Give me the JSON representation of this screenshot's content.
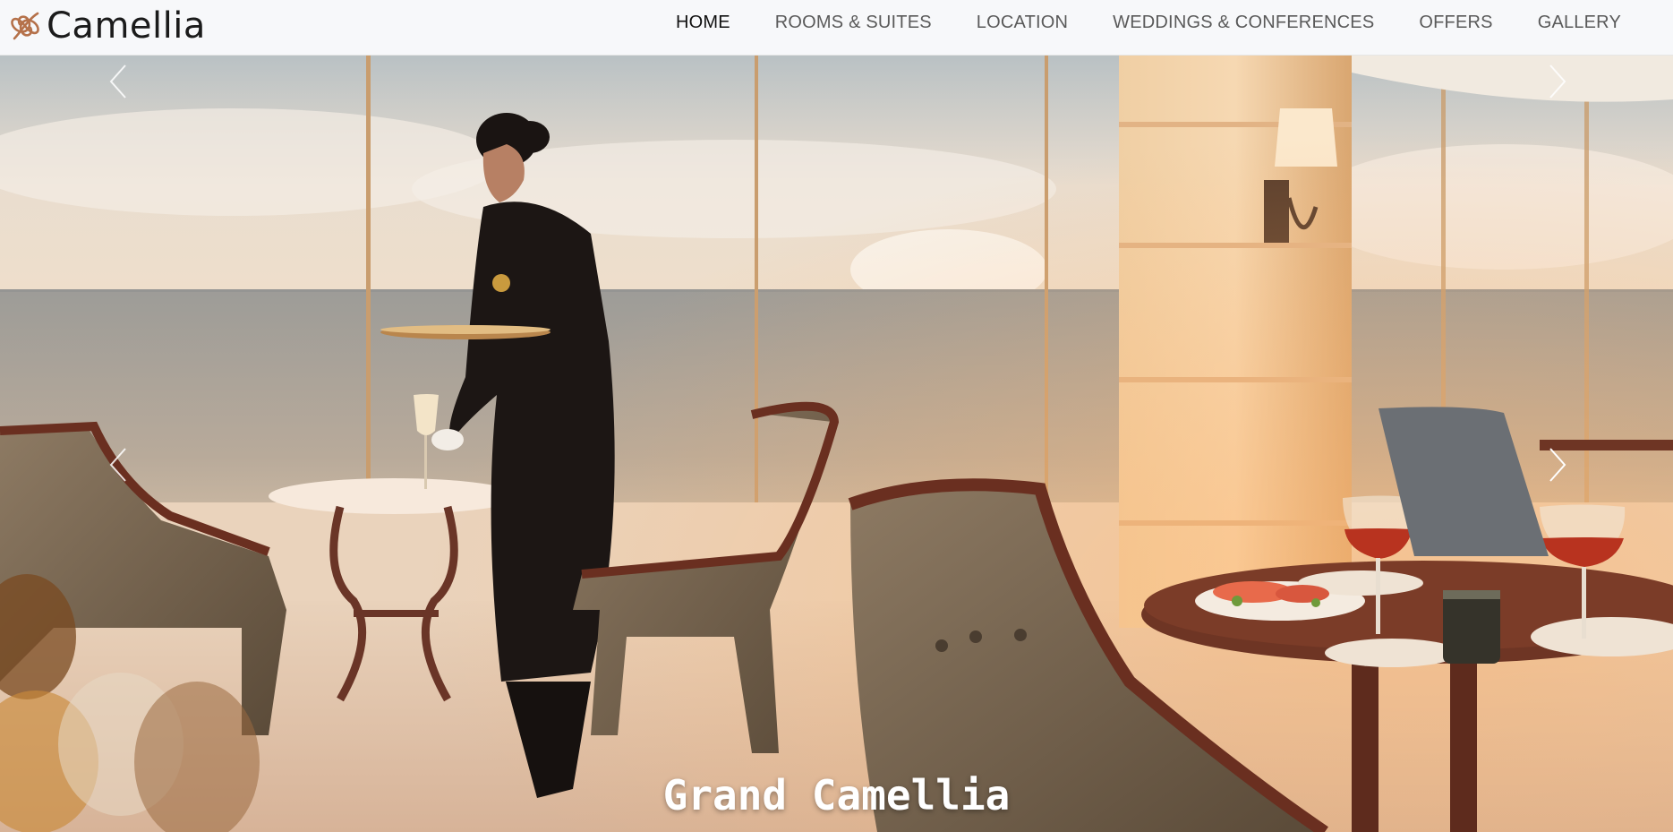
{
  "brand": {
    "name": "Camellia",
    "logo_icon": "camellia-knot-logo-icon",
    "logo_color": "#b5714a"
  },
  "nav": {
    "items": [
      {
        "label": "HOME",
        "active": true
      },
      {
        "label": "ROOMS & SUITES",
        "active": false
      },
      {
        "label": "LOCATION",
        "active": false
      },
      {
        "label": "WEDDINGS & CONFERENCES",
        "active": false
      },
      {
        "label": "OFFERS",
        "active": false
      },
      {
        "label": "GALLERY",
        "active": false
      }
    ]
  },
  "hero": {
    "caption": "Grand Camellia",
    "image": "restaurant-ocean-view-photo",
    "controls": {
      "prev_icon": "chevron-left-icon",
      "next_icon": "chevron-right-icon"
    }
  },
  "colors": {
    "nav_bg": "#f7f8fa",
    "nav_text": "#5a5a5a",
    "nav_active": "#111111",
    "caption": "#ffffff"
  }
}
